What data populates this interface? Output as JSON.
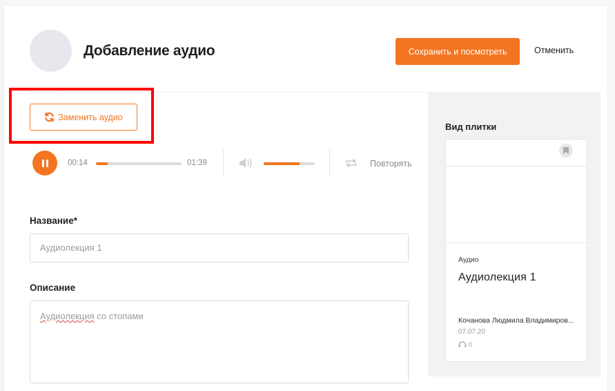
{
  "header": {
    "title": "Добавление аудио",
    "save_label": "Сохранить и посмотреть",
    "cancel_label": "Отменить"
  },
  "audio": {
    "replace_label": "Заменить аудио",
    "current_time": "00:14",
    "duration": "01:39",
    "progress_fraction": 0.14,
    "volume_fraction": 0.7,
    "repeat_label": "Повторять"
  },
  "form": {
    "title_label": "Название*",
    "title_value": "Аудиолекция 1",
    "description_label": "Описание",
    "description_word1": "Аудиолекция",
    "description_rest": " со стопами"
  },
  "preview": {
    "panel_title": "Вид плитки",
    "type": "Аудио",
    "name": "Аудиолекция 1",
    "author": "Кочанова Людмила Владимиров...",
    "date": "07.07.20",
    "views": "0"
  },
  "colors": {
    "accent": "#f37521",
    "highlight": "#ff0000"
  },
  "icons": [
    "refresh-icon",
    "pause-icon",
    "volume-icon",
    "repeat-icon",
    "bookmark-icon",
    "listens-icon"
  ]
}
